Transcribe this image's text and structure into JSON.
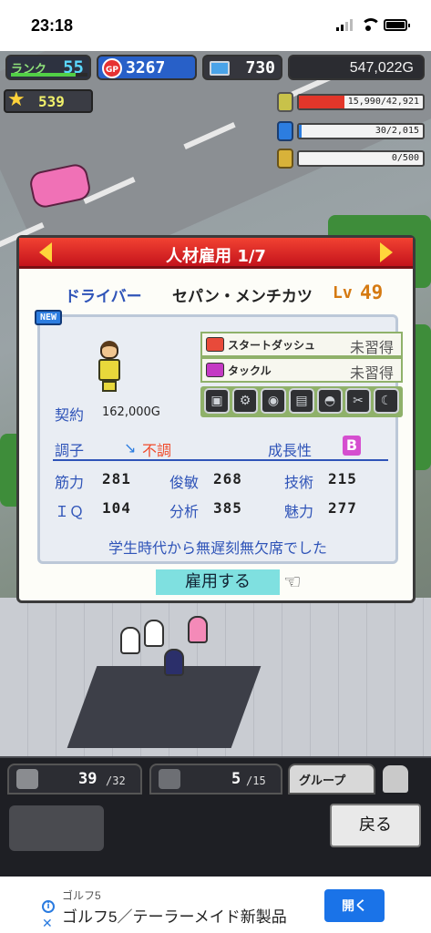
{
  "status_bar": {
    "time": "23:18"
  },
  "hud": {
    "rank_label": "ランク",
    "rank_value": "55",
    "rank_progress": 0.85,
    "gp_icon_label": "GP",
    "gp_value": "3267",
    "pc_value": "730",
    "gold_value": "547,022G",
    "star_value": "539",
    "resources": [
      {
        "icon": "fuel-barrel-icon",
        "text": "15,990/42,921",
        "fill": 0.37,
        "color": "#e2362a"
      },
      {
        "icon": "oil-bottle-icon",
        "text": "30/2,015",
        "fill": 0.02,
        "color": "#2c7de0"
      },
      {
        "icon": "grain-icon",
        "text": "0/500",
        "fill": 0.0,
        "color": "#d8b23a"
      }
    ]
  },
  "dialog": {
    "title": "人材雇用 1/7",
    "job_title": "ドライバー",
    "staff_name": "セパン・メンチカツ",
    "level_label": "Lv",
    "level_value": "49",
    "new_badge": "NEW",
    "contract_label": "契約",
    "contract_value": "162,000G",
    "skills": [
      {
        "name": "スタートダッシュ",
        "status": "未習得",
        "icon_color": "#e84a3a"
      },
      {
        "name": "タックル",
        "status": "未習得",
        "icon_color": "#c43ac4"
      }
    ],
    "equipment_icons": [
      "body-icon",
      "engine-icon",
      "tire-icon",
      "seat-icon",
      "helmet-icon",
      "tool-icon",
      "moon-icon"
    ],
    "condition_label": "調子",
    "condition_value": "不調",
    "growth_label": "成長性",
    "growth_value": "B",
    "stats": {
      "strength_label": "筋力",
      "strength_value": "281",
      "agility_label": "俊敏",
      "agility_value": "268",
      "technique_label": "技術",
      "technique_value": "215",
      "iq_label": "ＩＱ",
      "iq_value": "104",
      "analysis_label": "分析",
      "analysis_value": "385",
      "charm_label": "魅力",
      "charm_value": "277"
    },
    "flavor_text": "学生時代から無遅刻無欠席でした",
    "hire_button": "雇用する"
  },
  "bottom_panel": {
    "tab1_value": "39",
    "tab1_max": "32",
    "tab2_value": "5",
    "tab2_max": "15",
    "group_label": "グループ",
    "back_button": "戻る"
  },
  "ad": {
    "sponsor": "ゴルフ5",
    "title": "ゴルフ5／テーラーメイド新製品",
    "open_button": "開く"
  }
}
